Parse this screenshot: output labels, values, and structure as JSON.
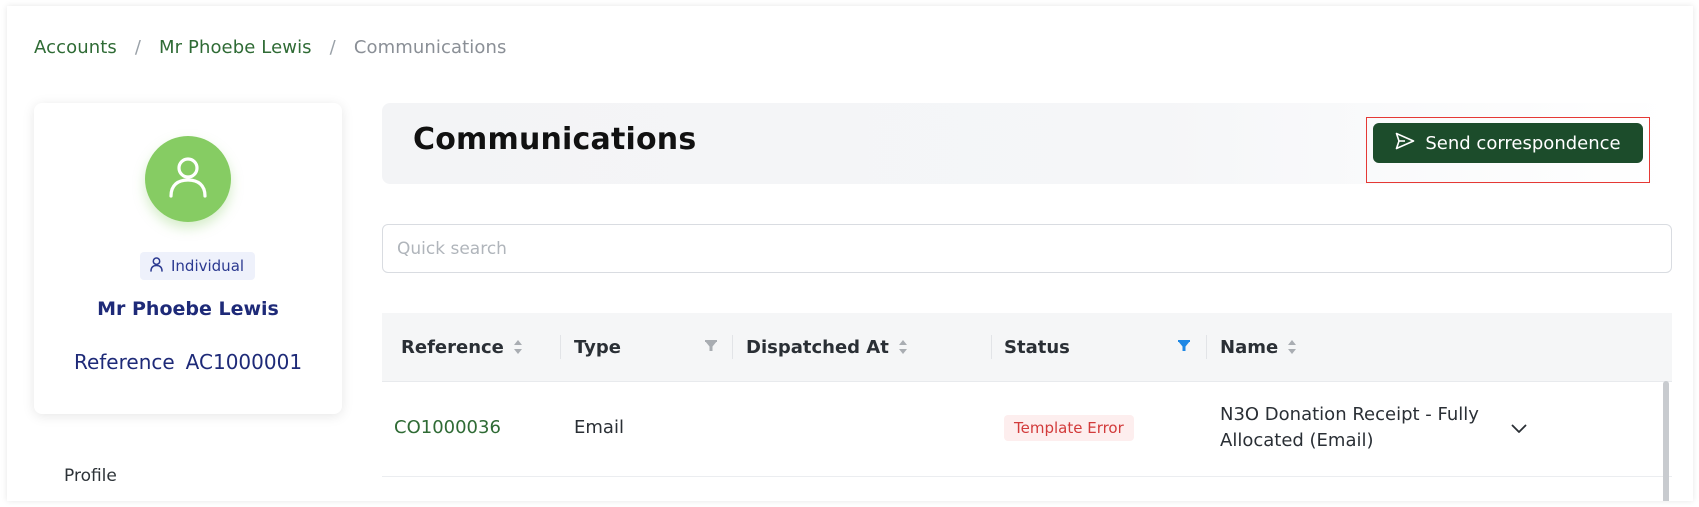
{
  "breadcrumb": {
    "items": [
      "Accounts",
      "Mr Phoebe Lewis"
    ],
    "separator": "/",
    "current": "Communications"
  },
  "profile": {
    "type_label": "Individual",
    "name": "Mr Phoebe Lewis",
    "reference_label": "Reference",
    "reference_value": "AC1000001",
    "avatar_color": "#86cc63"
  },
  "sidebar": {
    "items": [
      {
        "label": "Profile"
      }
    ]
  },
  "header": {
    "title": "Communications",
    "send_button_label": "Send correspondence",
    "send_button_color": "#1c4c2b",
    "highlight_color": "#e53935"
  },
  "search": {
    "placeholder": "Quick search",
    "value": ""
  },
  "table": {
    "columns": [
      {
        "label": "Reference",
        "control": "sort"
      },
      {
        "label": "Type",
        "control": "filter"
      },
      {
        "label": "Dispatched At",
        "control": "sort"
      },
      {
        "label": "Status",
        "control": "filter-active"
      },
      {
        "label": "Name",
        "control": "sort"
      }
    ],
    "rows": [
      {
        "reference": "CO1000036",
        "type": "Email",
        "dispatched_at": "",
        "status": "Template Error",
        "name": "N3O Donation Receipt - Fully Allocated (Email)"
      }
    ],
    "status_colors": {
      "Template Error": "#d23b3b"
    },
    "filter_active_color": "#1e88e5"
  }
}
